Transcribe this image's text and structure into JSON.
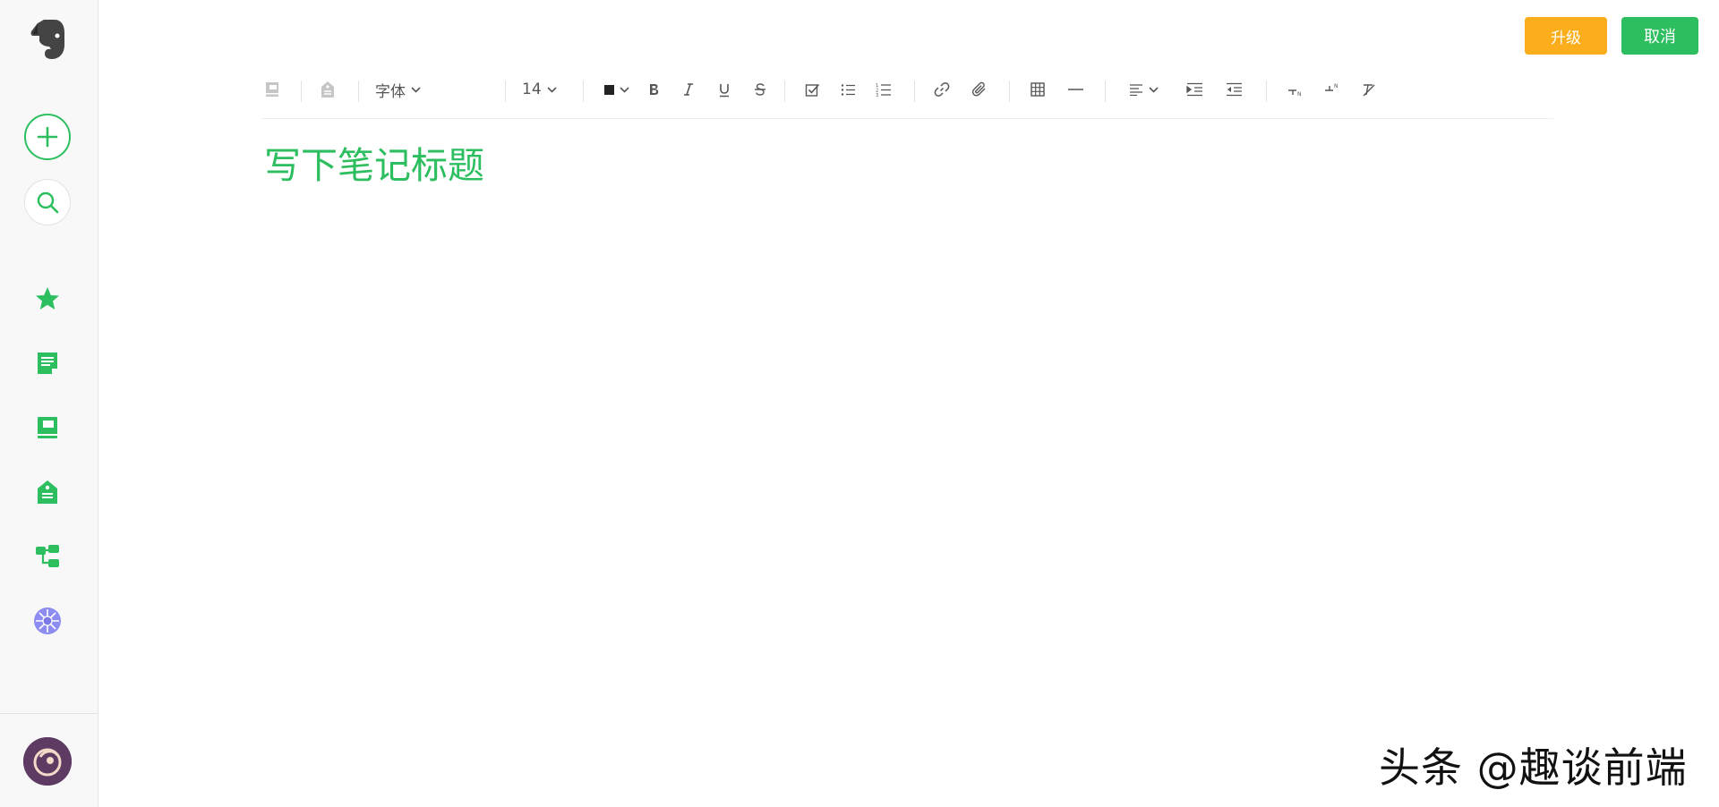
{
  "sidebar": {
    "items": [
      {
        "icon": "evernote-logo-icon"
      },
      {
        "icon": "plus-icon"
      },
      {
        "icon": "search-icon"
      },
      {
        "icon": "star-icon"
      },
      {
        "icon": "note-icon"
      },
      {
        "icon": "notebook-icon"
      },
      {
        "icon": "tag-icon"
      },
      {
        "icon": "work-chat-icon"
      },
      {
        "icon": "spaces-icon"
      }
    ],
    "avatar": "user-avatar"
  },
  "header": {
    "upgrade_label": "升级",
    "cancel_label": "取消"
  },
  "toolbar": {
    "font_label": "字体",
    "size_label": "14",
    "tools": [
      "notebook",
      "tag",
      "font",
      "font-size",
      "font-color",
      "bold",
      "italic",
      "underline",
      "strikethrough",
      "checkbox",
      "bullet-list",
      "numbered-list",
      "link",
      "attachment",
      "table",
      "horizontal-rule",
      "align",
      "indent",
      "outdent",
      "subscript",
      "superscript",
      "clear-format"
    ]
  },
  "editor": {
    "title_placeholder": "写下笔记标题",
    "body": ""
  },
  "watermark": "头条 @趣谈前端",
  "colors": {
    "accent": "#2dbe60",
    "upgrade": "#fbad1b",
    "sidebar_bg": "#f8f8f8"
  }
}
